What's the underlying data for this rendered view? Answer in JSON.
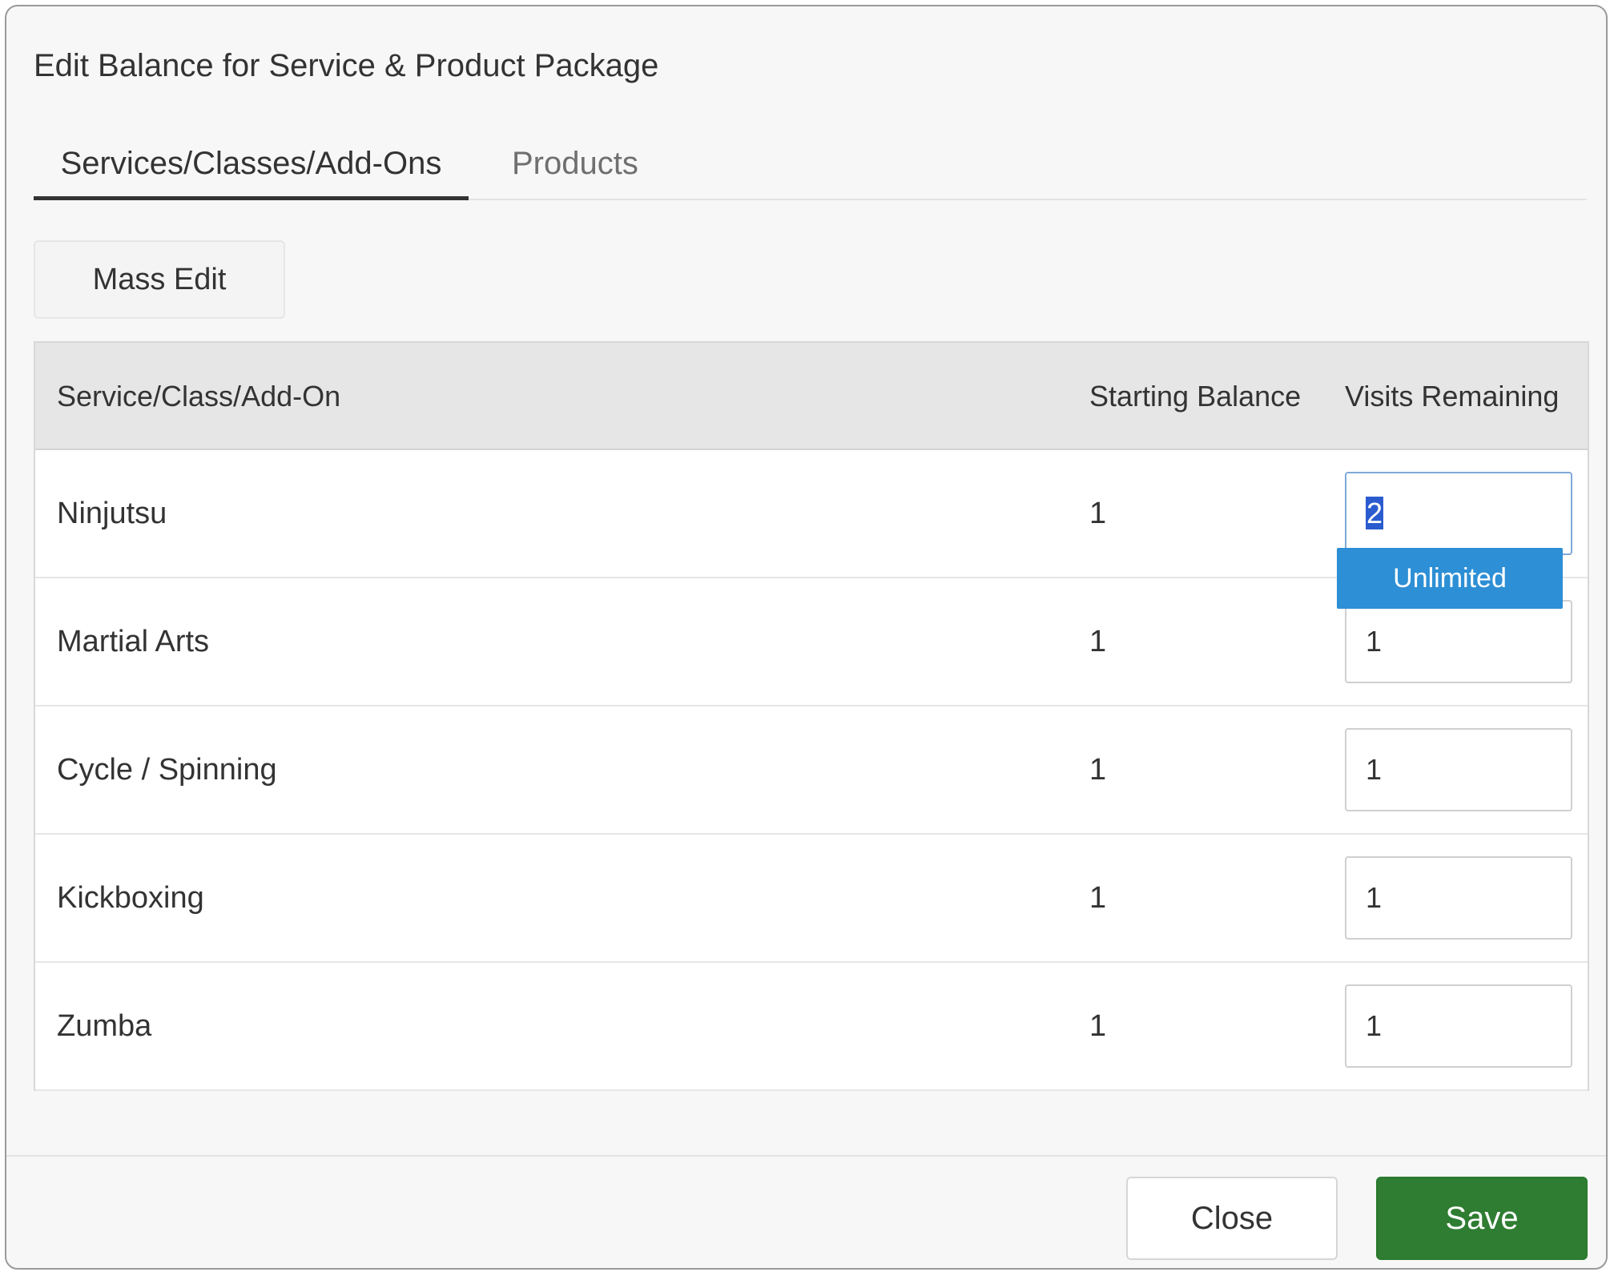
{
  "dialog": {
    "title": "Edit Balance for Service & Product Package"
  },
  "tabs": [
    {
      "label": "Services/Classes/Add-Ons",
      "active": true
    },
    {
      "label": "Products",
      "active": false
    }
  ],
  "toolbar": {
    "mass_edit_label": "Mass Edit"
  },
  "table": {
    "headers": {
      "name": "Service/Class/Add-On",
      "starting_balance": "Starting Balance",
      "visits_remaining": "Visits Remaining"
    },
    "rows": [
      {
        "name": "Ninjutsu",
        "starting_balance": "1",
        "visits_remaining": "2"
      },
      {
        "name": "Martial Arts",
        "starting_balance": "1",
        "visits_remaining": "1"
      },
      {
        "name": "Cycle / Spinning",
        "starting_balance": "1",
        "visits_remaining": "1"
      },
      {
        "name": "Kickboxing",
        "starting_balance": "1",
        "visits_remaining": "1"
      },
      {
        "name": "Zumba",
        "starting_balance": "1",
        "visits_remaining": "1"
      }
    ]
  },
  "dropdown": {
    "option": "Unlimited"
  },
  "footer": {
    "close_label": "Close",
    "save_label": "Save"
  },
  "colors": {
    "save_button": "#2f7d32",
    "dropdown_highlight": "#2d8fd5",
    "text_selection": "#2b5ccf"
  }
}
